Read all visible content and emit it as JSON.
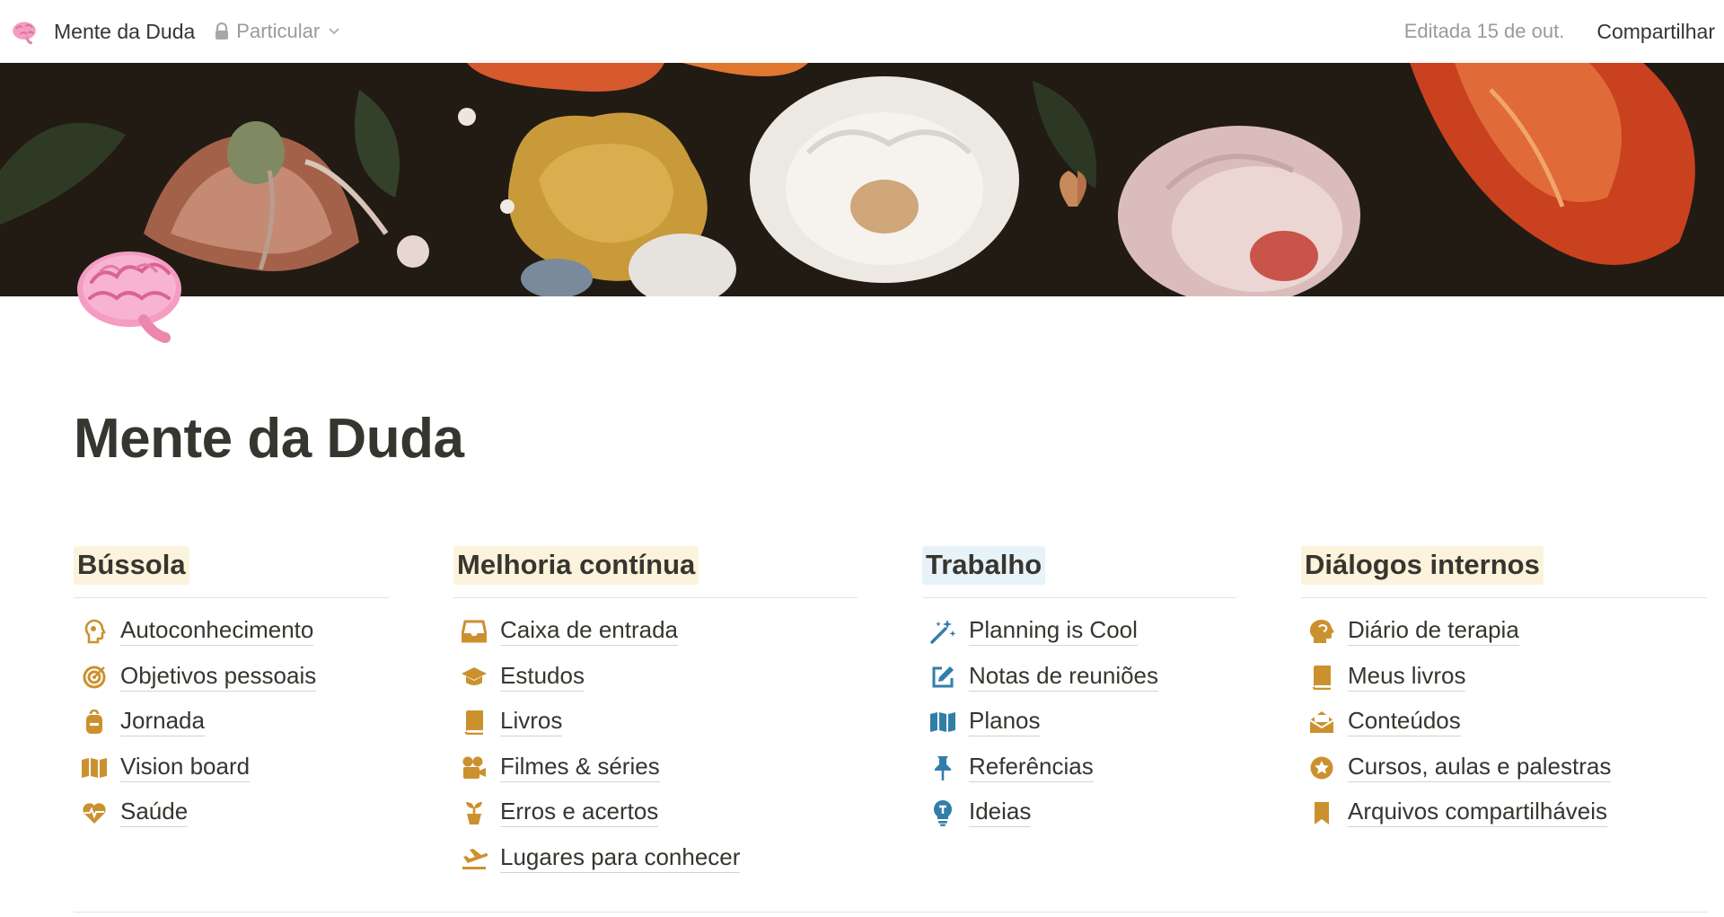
{
  "topbar": {
    "page_title": "Mente da Duda",
    "privacy": "Particular",
    "edited": "Editada 15 de out.",
    "share": "Compartilhar"
  },
  "page": {
    "title": "Mente da Duda",
    "icon": "brain-emoji"
  },
  "colors": {
    "icon_gold": "#cb912f",
    "icon_blue": "#337ea9",
    "highlight_yellow": "#fbf3db",
    "highlight_blue": "#e7f3f8"
  },
  "columns": [
    {
      "heading": "Bússola",
      "highlight": "yellow",
      "items": [
        {
          "label": "Autoconhecimento",
          "icon": "person-profile-icon"
        },
        {
          "label": "Objetivos pessoais",
          "icon": "target-icon"
        },
        {
          "label": "Jornada",
          "icon": "backpack-icon"
        },
        {
          "label": "Vision board",
          "icon": "map-icon"
        },
        {
          "label": "Saúde",
          "icon": "heart-rate-icon"
        }
      ]
    },
    {
      "heading": "Melhoria contínua",
      "highlight": "yellow",
      "items": [
        {
          "label": "Caixa de entrada",
          "icon": "inbox-icon"
        },
        {
          "label": "Estudos",
          "icon": "graduation-cap-icon"
        },
        {
          "label": "Livros",
          "icon": "book-icon"
        },
        {
          "label": "Filmes & séries",
          "icon": "film-camera-icon"
        },
        {
          "label": "Erros e acertos",
          "icon": "sprout-icon"
        },
        {
          "label": "Lugares para conhecer",
          "icon": "airplane-icon"
        }
      ]
    },
    {
      "heading": "Trabalho",
      "highlight": "blue",
      "items": [
        {
          "label": "Planning is Cool",
          "icon": "magic-wand-icon"
        },
        {
          "label": "Notas de reuniões",
          "icon": "edit-icon"
        },
        {
          "label": "Planos",
          "icon": "map-icon"
        },
        {
          "label": "Referências",
          "icon": "pin-icon"
        },
        {
          "label": "Ideias",
          "icon": "lightbulb-icon"
        }
      ]
    },
    {
      "heading": "Diálogos internos",
      "highlight": "yellow",
      "items": [
        {
          "label": "Diário de terapia",
          "icon": "head-icon"
        },
        {
          "label": "Meus livros",
          "icon": "book-icon"
        },
        {
          "label": "Conteúdos",
          "icon": "open-envelope-icon"
        },
        {
          "label": "Cursos, aulas e palestras",
          "icon": "star-badge-icon"
        },
        {
          "label": "Arquivos compartilháveis",
          "icon": "bookmark-icon"
        }
      ]
    }
  ]
}
